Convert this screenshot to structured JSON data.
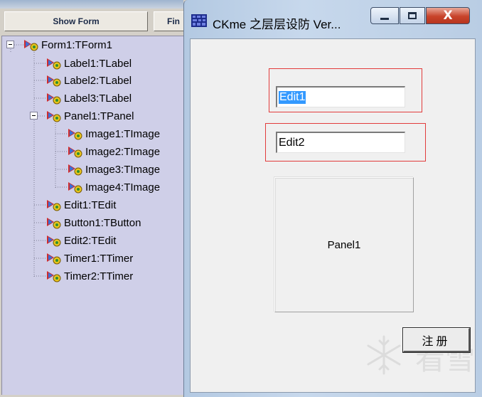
{
  "inspector": {
    "buttons": {
      "show_form": "Show Form",
      "find": "Fin"
    },
    "tree": [
      {
        "label": "Form1:TForm1"
      },
      {
        "label": "Label1:TLabel"
      },
      {
        "label": "Label2:TLabel"
      },
      {
        "label": "Label3:TLabel"
      },
      {
        "label": "Panel1:TPanel"
      },
      {
        "label": "Image1:TImage"
      },
      {
        "label": "Image2:TImage"
      },
      {
        "label": "Image3:TImage"
      },
      {
        "label": "Image4:TImage"
      },
      {
        "label": "Edit1:TEdit"
      },
      {
        "label": "Button1:TButton"
      },
      {
        "label": "Edit2:TEdit"
      },
      {
        "label": "Timer1:TTimer"
      },
      {
        "label": "Timer2:TTimer"
      }
    ]
  },
  "window": {
    "title": "CKme 之层层设防   Ver...",
    "icon": "app-grid-icon",
    "caption_buttons": [
      "minimize-icon",
      "maximize-icon",
      "close-icon"
    ],
    "close_glyph": "X"
  },
  "form": {
    "edit1": {
      "value": "Edit1",
      "selected": true
    },
    "edit2": {
      "value": "Edit2"
    },
    "panel1": {
      "caption": "Panel1"
    },
    "register_button": {
      "label": "注册"
    },
    "highlight_color": "#e23b3b",
    "selection_color": "#3399ff"
  },
  "watermark": {
    "text": "看雪",
    "icon": "snowflake-icon"
  }
}
